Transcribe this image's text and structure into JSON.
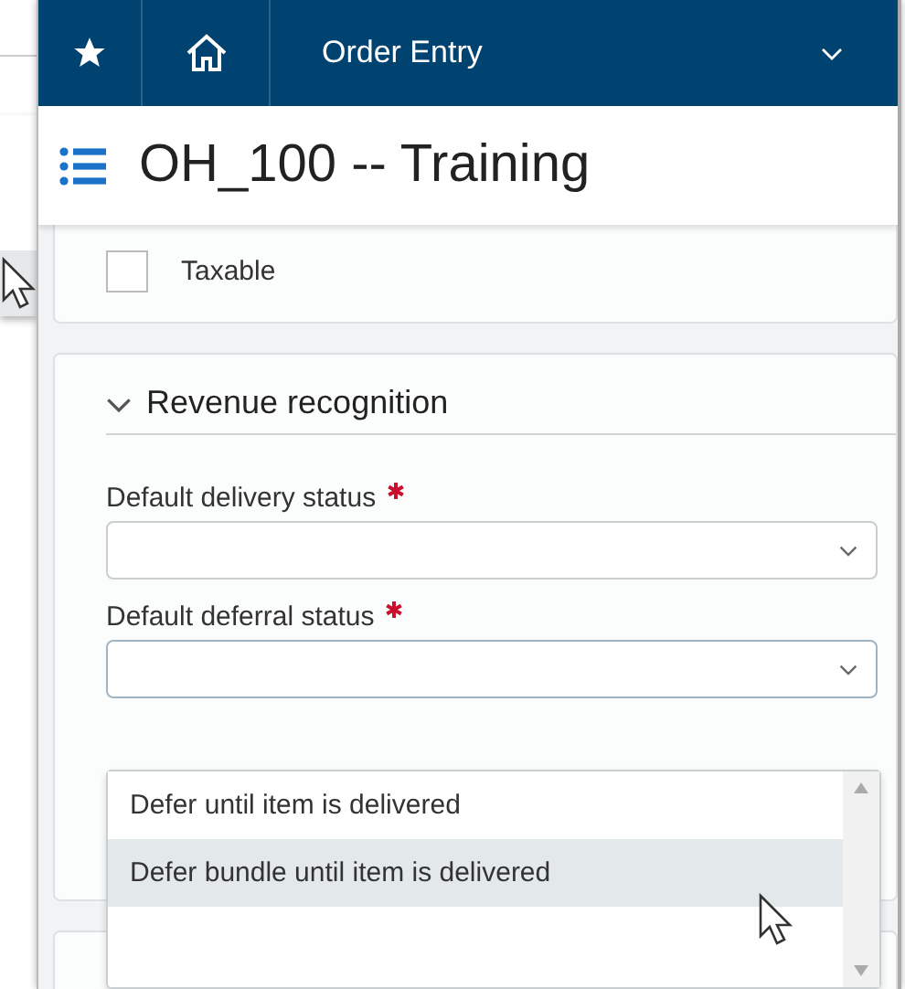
{
  "header": {
    "title": "Order Entry"
  },
  "page_title": "OH_100 -- Training",
  "taxable": {
    "label": "Taxable",
    "checked": false
  },
  "section": {
    "title": "Revenue recognition",
    "expanded": true,
    "fields": [
      {
        "label": "Default delivery status",
        "required": true,
        "open": false
      },
      {
        "label": "Default deferral status",
        "required": true,
        "open": true
      }
    ]
  },
  "dropdown": {
    "options": [
      {
        "label": "Defer until item is delivered",
        "selected": false
      },
      {
        "label": "Defer bundle until item is delivered",
        "selected": true
      }
    ]
  }
}
